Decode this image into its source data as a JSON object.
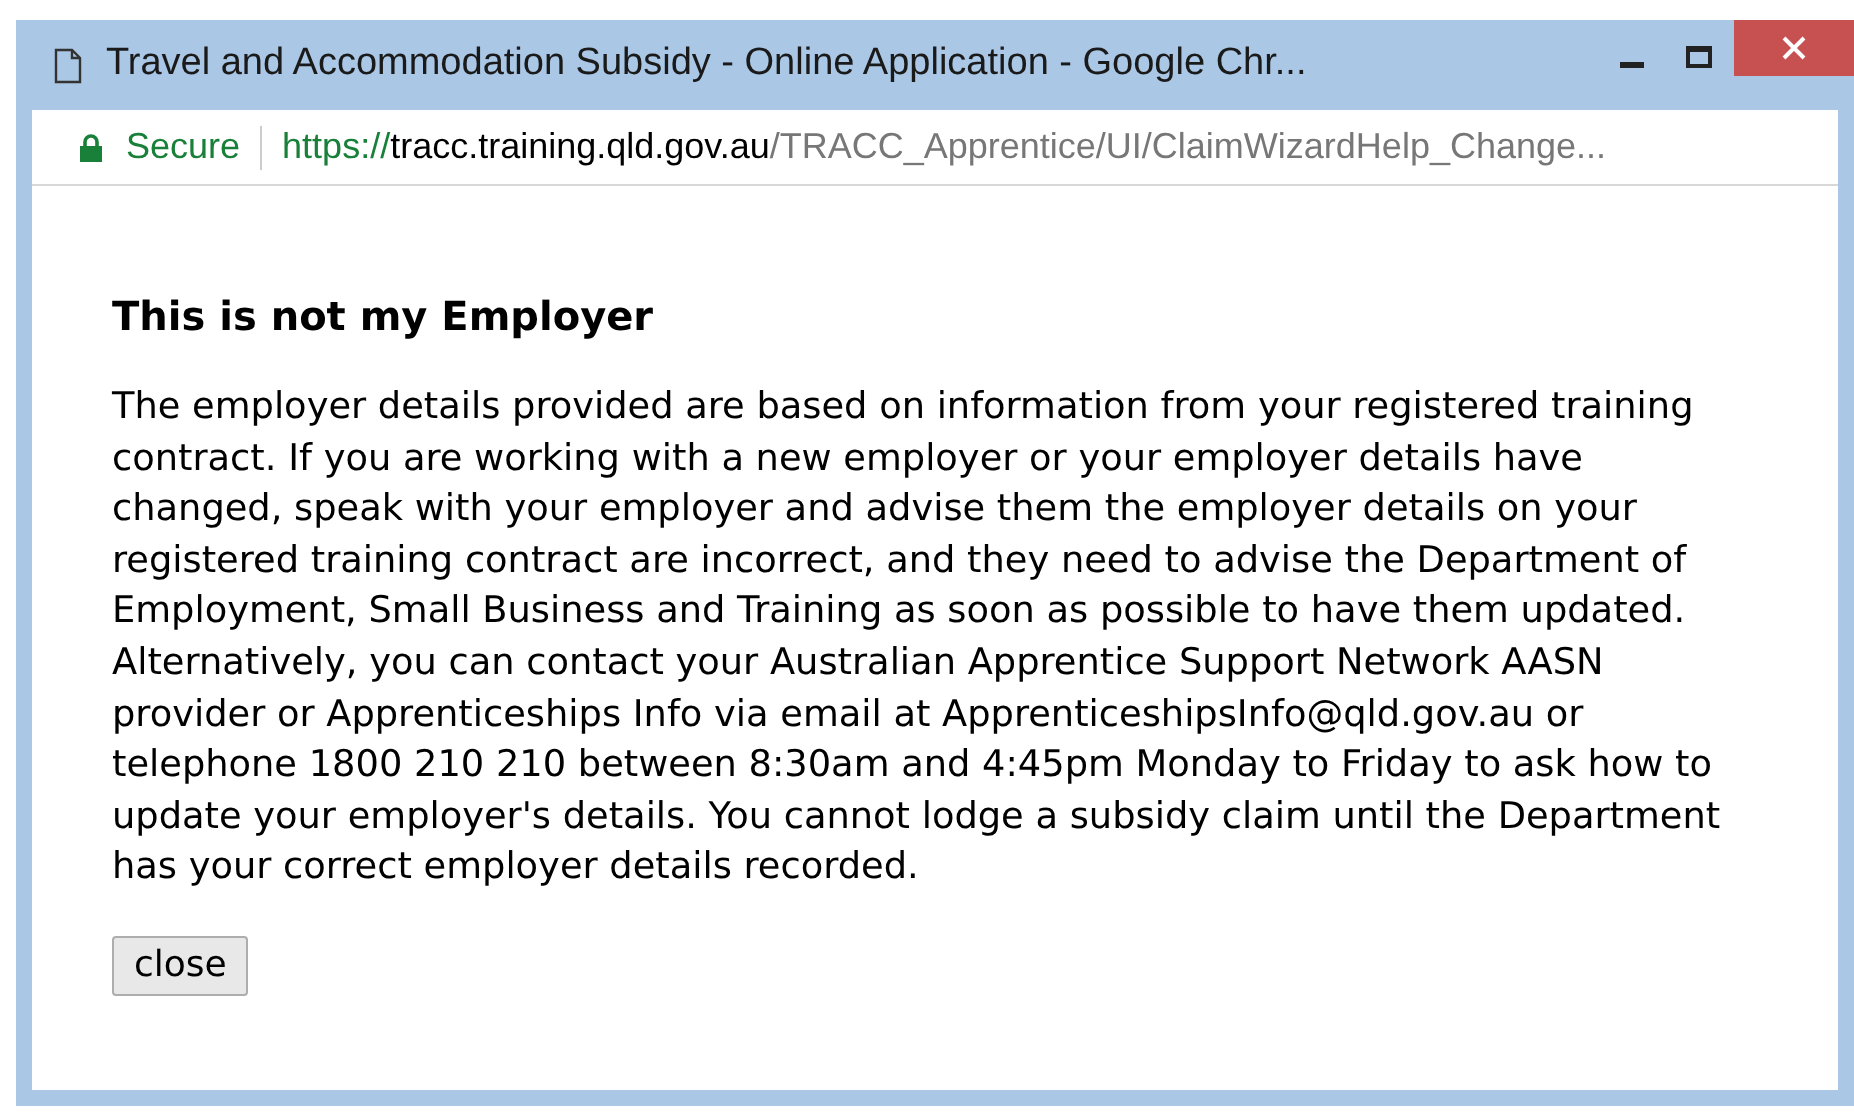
{
  "window": {
    "title": "Travel and Accommodation Subsidy - Online Application - Google Chr..."
  },
  "address_bar": {
    "security": "Secure",
    "url_scheme": "https://",
    "url_host": "tracc.training.qld.gov.au",
    "url_path": "/TRACC_Apprentice/UI/ClaimWizardHelp_Change..."
  },
  "dialog": {
    "heading": "This is not my Employer",
    "body": "The employer details provided are based on information from your registered training contract. If you are working with a new employer or your employer details have changed, speak with your employer and advise them the employer details on your registered training contract are incorrect, and they need to advise the Department of Employment, Small Business and Training as soon as possible to have them updated. Alternatively, you can contact your Australian Apprentice Support Network AASN provider or Apprenticeships Info via email at ApprenticeshipsInfo@qld.gov.au or telephone 1800 210 210 between 8:30am and 4:45pm Monday to Friday to ask how to update your employer's details. You cannot lodge a subsidy claim until the Department has your correct employer details recorded.",
    "buttons": [
      "close"
    ]
  }
}
